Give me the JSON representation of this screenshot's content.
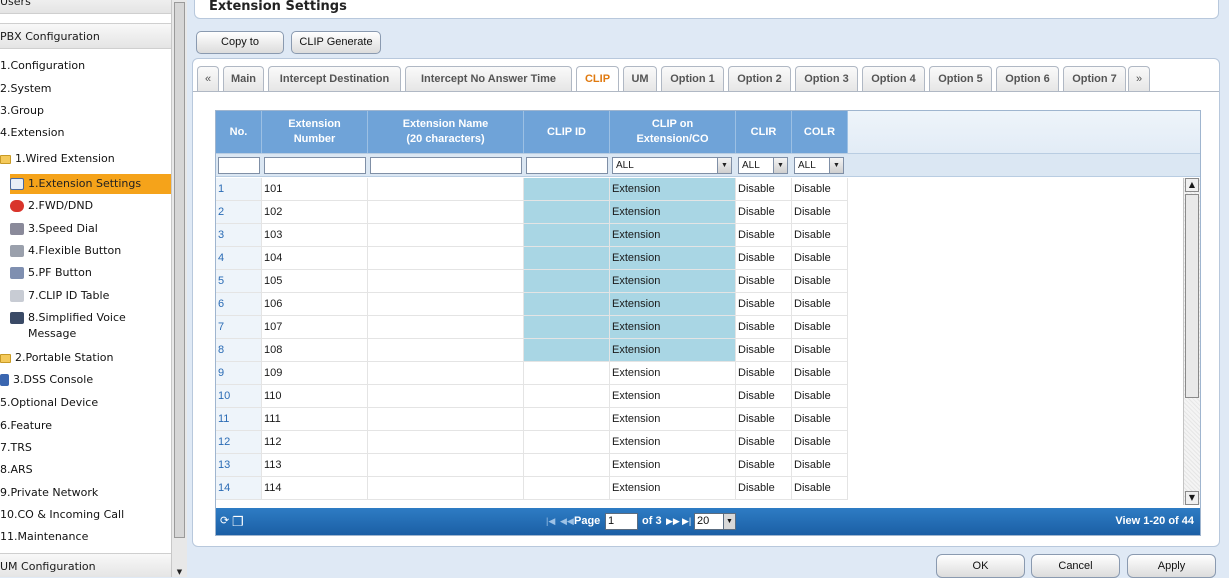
{
  "sidebar": {
    "sections": [
      "Users",
      "PBX Configuration",
      "UM Configuration"
    ],
    "items": [
      "1.Configuration",
      "2.System",
      "3.Group",
      "4.Extension",
      "1.Wired Extension",
      "1.Extension Settings",
      "2.FWD/DND",
      "3.Speed Dial",
      "4.Flexible Button",
      "5.PF Button",
      "7.CLIP ID Table",
      "8.Simplified Voice",
      "Message",
      "2.Portable Station",
      "3.DSS Console",
      "5.Optional Device",
      "6.Feature",
      "7.TRS",
      "8.ARS",
      "9.Private Network",
      "10.CO & Incoming Call",
      "11.Maintenance"
    ],
    "icons": [
      "envelope-icon",
      "forward-icon",
      "speed-dial-icon",
      "flexible-button-icon",
      "pf-button-icon",
      "clip-table-icon",
      "voice-message-icon",
      "dss-console-icon"
    ]
  },
  "page": {
    "title": "Extension Settings",
    "copy_to_label": "Copy to",
    "clip_generate_label": "CLIP Generate"
  },
  "tabs": {
    "prev": "«",
    "next": "»",
    "labels": [
      "Main",
      "Intercept Destination",
      "Intercept No Answer Time",
      "CLIP",
      "UM",
      "Option 1",
      "Option 2",
      "Option 3",
      "Option 4",
      "Option 5",
      "Option 6",
      "Option 7"
    ],
    "active": "CLIP"
  },
  "grid": {
    "headers": {
      "no": "No.",
      "ext_number_1": "Extension",
      "ext_number_2": "Number",
      "ext_name_1": "Extension Name",
      "ext_name_2": "(20 characters)",
      "clip_id": "CLIP ID",
      "clip_on_1": "CLIP on",
      "clip_on_2": "Extension/CO",
      "clir": "CLIR",
      "colr": "COLR"
    },
    "filters": {
      "clip_on": "ALL",
      "clir": "ALL",
      "colr": "ALL"
    },
    "rows": [
      [
        "1",
        "101",
        "",
        "",
        "Extension",
        "Disable",
        "Disable"
      ],
      [
        "2",
        "102",
        "",
        "",
        "Extension",
        "Disable",
        "Disable"
      ],
      [
        "3",
        "103",
        "",
        "",
        "Extension",
        "Disable",
        "Disable"
      ],
      [
        "4",
        "104",
        "",
        "",
        "Extension",
        "Disable",
        "Disable"
      ],
      [
        "5",
        "105",
        "",
        "",
        "Extension",
        "Disable",
        "Disable"
      ],
      [
        "6",
        "106",
        "",
        "",
        "Extension",
        "Disable",
        "Disable"
      ],
      [
        "7",
        "107",
        "",
        "",
        "Extension",
        "Disable",
        "Disable"
      ],
      [
        "8",
        "108",
        "",
        "",
        "Extension",
        "Disable",
        "Disable"
      ],
      [
        "9",
        "109",
        "",
        "",
        "Extension",
        "Disable",
        "Disable"
      ],
      [
        "10",
        "110",
        "",
        "",
        "Extension",
        "Disable",
        "Disable"
      ],
      [
        "11",
        "111",
        "",
        "",
        "Extension",
        "Disable",
        "Disable"
      ],
      [
        "12",
        "112",
        "",
        "",
        "Extension",
        "Disable",
        "Disable"
      ],
      [
        "13",
        "113",
        "",
        "",
        "Extension",
        "Disable",
        "Disable"
      ],
      [
        "14",
        "114",
        "",
        "",
        "Extension",
        "Disable",
        "Disable"
      ]
    ],
    "highlighted_rows": 8
  },
  "pager": {
    "page_label": "Page",
    "page_value": "1",
    "of_label": "of 3",
    "per_page": "20",
    "view_text": "View 1-20 of 44"
  },
  "footer": {
    "ok_label": "OK",
    "cancel_label": "Cancel",
    "apply_label": "Apply"
  }
}
